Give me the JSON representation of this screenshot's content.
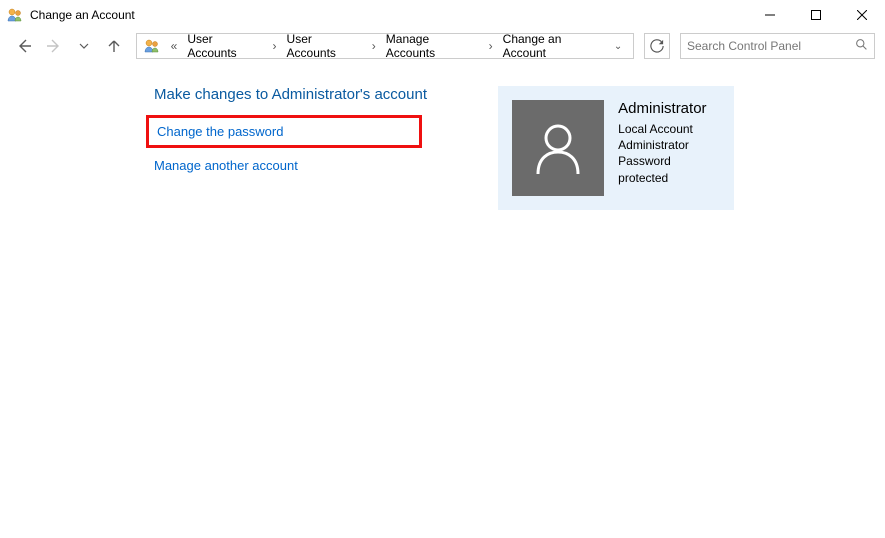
{
  "window": {
    "title": "Change an Account"
  },
  "breadcrumb": {
    "prefix": "«",
    "items": [
      {
        "label": "User Accounts"
      },
      {
        "label": "User Accounts"
      },
      {
        "label": "Manage Accounts"
      },
      {
        "label": "Change an Account"
      }
    ]
  },
  "search": {
    "placeholder": "Search Control Panel"
  },
  "heading": "Make changes to Administrator's account",
  "links": {
    "change_password": "Change the password",
    "manage_another": "Manage another account"
  },
  "account": {
    "name": "Administrator",
    "type": "Local Account",
    "role": "Administrator",
    "status": "Password protected"
  }
}
